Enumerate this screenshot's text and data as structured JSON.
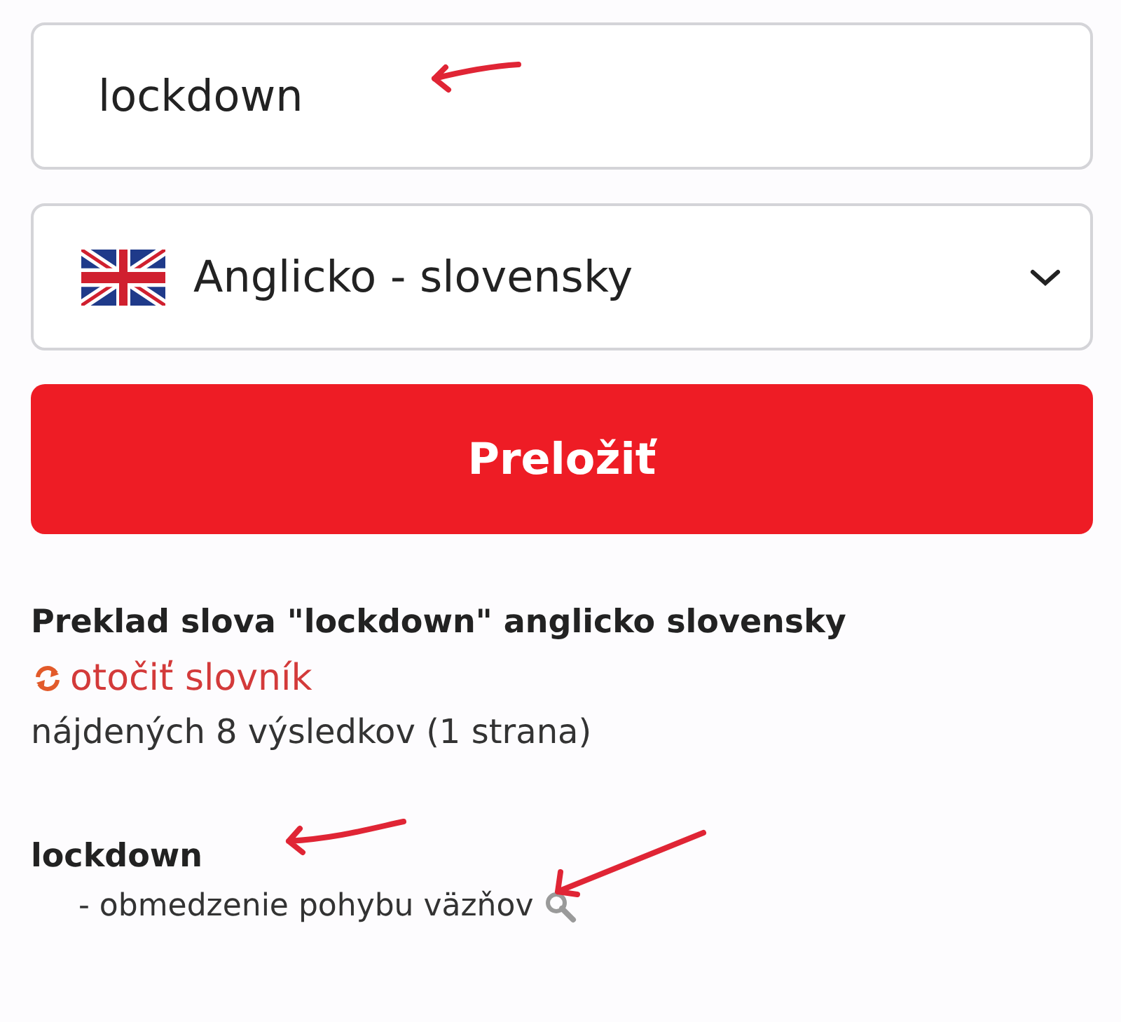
{
  "search": {
    "value": "lockdown"
  },
  "language_select": {
    "label": "Anglicko - slovensky"
  },
  "translate_button": {
    "label": "Preložiť"
  },
  "result_heading": "Preklad slova \"lockdown\" anglicko slovensky",
  "swap_link": {
    "label": "otočiť slovník"
  },
  "result_count": "nájdených 8 výsledkov (1 strana)",
  "entries": [
    {
      "term": "lockdown",
      "translations": [
        "- obmedzenie pohybu väzňov"
      ]
    }
  ]
}
